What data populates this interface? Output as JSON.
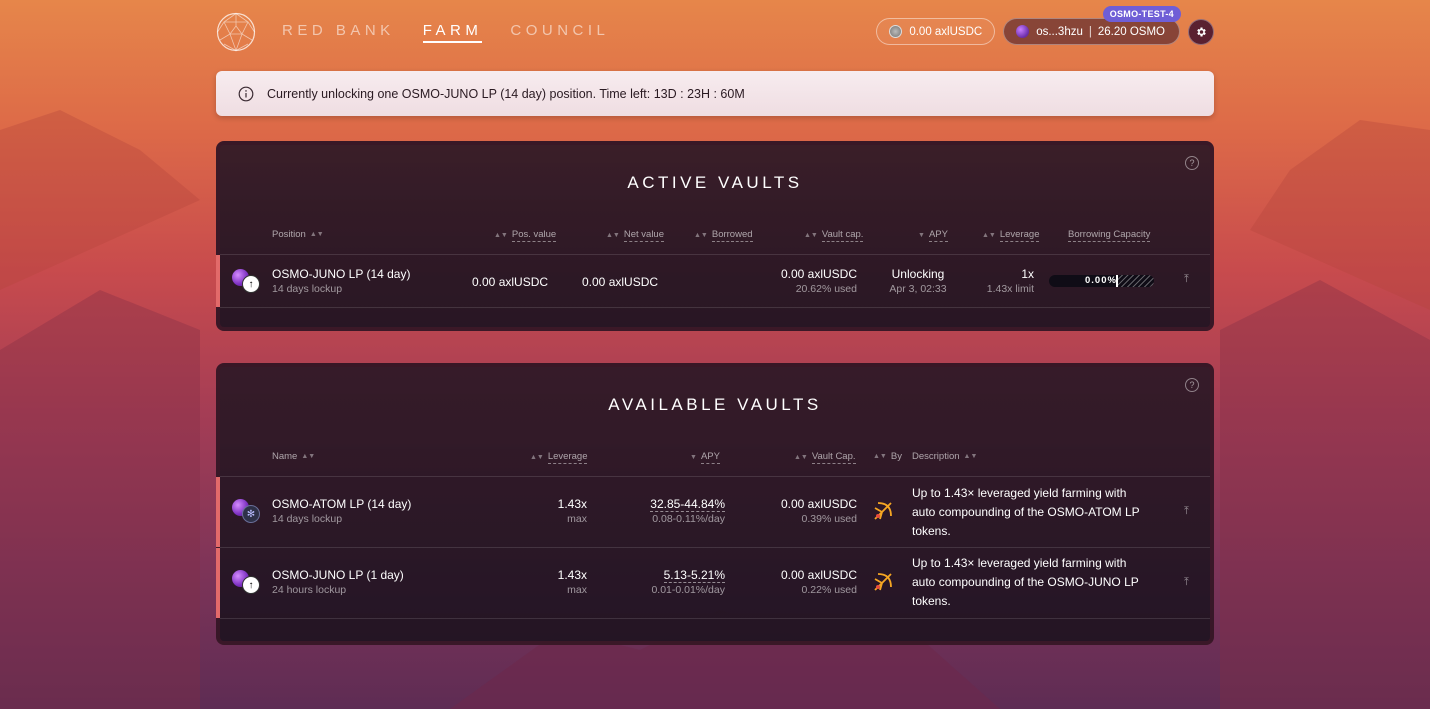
{
  "nav": {
    "items": [
      {
        "label": "RED BANK"
      },
      {
        "label": "FARM"
      },
      {
        "label": "COUNCIL"
      }
    ]
  },
  "header": {
    "balance": "0.00 axlUSDC",
    "wallet_address": "os...3hzu",
    "wallet_balance": "26.20 OSMO",
    "network_badge": "OSMO-TEST-4"
  },
  "banner": {
    "text": "Currently unlocking one OSMO-JUNO LP (14 day) position. Time left: 13D : 23H : 60M"
  },
  "active_vaults": {
    "title": "ACTIVE VAULTS",
    "help": "?",
    "columns": {
      "position": "Position",
      "pos_value": "Pos. value",
      "net_value": "Net value",
      "borrowed": "Borrowed",
      "vault_cap": "Vault cap.",
      "apy": "APY",
      "leverage": "Leverage",
      "borrowing_capacity": "Borrowing Capacity"
    },
    "rows": [
      {
        "name": "OSMO-JUNO LP (14 day)",
        "lockup": "14 days lockup",
        "pos_value": "0.00 axlUSDC",
        "net_value": "0.00 axlUSDC",
        "vault_cap": "0.00 axlUSDC",
        "vault_cap_used": "20.62% used",
        "apy_status": "Unlocking",
        "apy_date": "Apr 3, 02:33",
        "leverage": "1x",
        "leverage_limit": "1.43x limit",
        "borrow_pct": "0.00%",
        "borrow_fraction": 0.0
      }
    ]
  },
  "available_vaults": {
    "title": "AVAILABLE VAULTS",
    "help": "?",
    "columns": {
      "name": "Name",
      "leverage": "Leverage",
      "apy": "APY",
      "vault_cap": "Vault Cap.",
      "by": "By",
      "description": "Description"
    },
    "rows": [
      {
        "name": "OSMO-ATOM LP (14 day)",
        "lockup": "14 days lockup",
        "leverage": "1.43x",
        "leverage_sub": "max",
        "apy": "32.85-44.84%",
        "apy_day": "0.08-0.11%/day",
        "vault_cap": "0.00 axlUSDC",
        "vault_cap_used": "0.39% used",
        "description": "Up to 1.43× leveraged yield farming with auto compounding of the OSMO-ATOM LP tokens."
      },
      {
        "name": "OSMO-JUNO LP (1 day)",
        "lockup": "24 hours lockup",
        "leverage": "1.43x",
        "leverage_sub": "max",
        "apy": "5.13-5.21%",
        "apy_day": "0.01-0.01%/day",
        "vault_cap": "0.00 axlUSDC",
        "vault_cap_used": "0.22% used",
        "description": "Up to 1.43× leveraged yield farming with auto compounding of the OSMO-JUNO LP tokens."
      }
    ]
  }
}
